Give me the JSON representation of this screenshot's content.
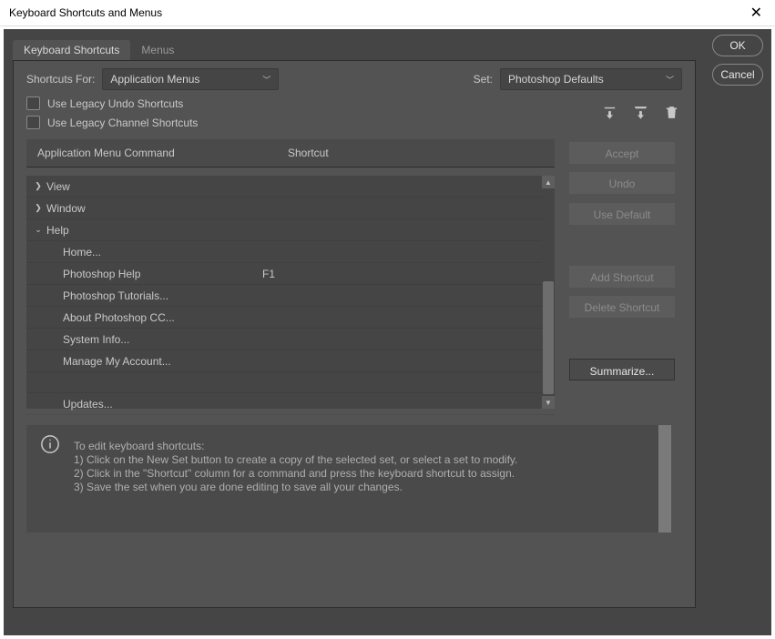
{
  "window": {
    "title": "Keyboard Shortcuts and Menus"
  },
  "buttons": {
    "ok": "OK",
    "cancel": "Cancel"
  },
  "tabs": {
    "shortcuts": "Keyboard Shortcuts",
    "menus": "Menus"
  },
  "top": {
    "shortcuts_for_label": "Shortcuts For:",
    "shortcuts_for_value": "Application Menus",
    "set_label": "Set:",
    "set_value": "Photoshop Defaults",
    "legacy_undo": "Use Legacy Undo Shortcuts",
    "legacy_channel": "Use Legacy Channel Shortcuts"
  },
  "headers": {
    "command": "Application Menu Command",
    "shortcut": "Shortcut"
  },
  "tree": {
    "view": "View",
    "window": "Window",
    "help": "Help",
    "help_items": [
      {
        "name": "Home...",
        "sc": ""
      },
      {
        "name": "Photoshop Help",
        "sc": "F1"
      },
      {
        "name": "Photoshop Tutorials...",
        "sc": ""
      },
      {
        "name": "About Photoshop CC...",
        "sc": ""
      },
      {
        "name": "System Info...",
        "sc": ""
      },
      {
        "name": "Manage My Account...",
        "sc": ""
      },
      {
        "name": "Updates...",
        "sc": ""
      }
    ]
  },
  "side": {
    "accept": "Accept",
    "undo": "Undo",
    "use_default": "Use Default",
    "add": "Add Shortcut",
    "delete": "Delete Shortcut",
    "summarize": "Summarize..."
  },
  "info": {
    "line0": "To edit keyboard shortcuts:",
    "line1": "1) Click on the New Set button to create a copy of the selected set, or select a set to modify.",
    "line2": "2) Click in the \"Shortcut\" column for a command and press the keyboard shortcut to assign.",
    "line3": "3) Save the set when you are done editing to save all your changes."
  }
}
